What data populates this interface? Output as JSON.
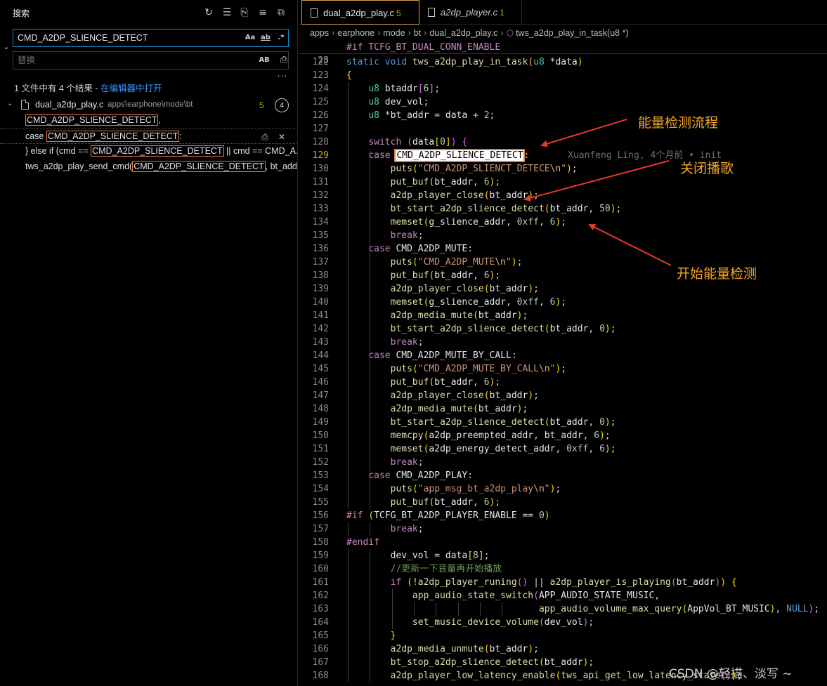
{
  "search_panel": {
    "title": "搜索",
    "search_value": "CMD_A2DP_SLIENCE_DETECT",
    "replace_placeholder": "替换",
    "opt_match_case": "Aa",
    "opt_whole_word": "ab",
    "opt_regex": ".*",
    "opt_preserve_case": "AB",
    "more": "...",
    "summary_text": "1 文件中有 4 个结果 - ",
    "summary_link": "在编辑器中打开",
    "file": {
      "name": "dual_a2dp_play.c",
      "path": "apps\\earphone\\mode\\bt",
      "problems": "5",
      "matches": "4"
    },
    "matches": [
      {
        "pre": "",
        "hit": "CMD_A2DP_SLIENCE_DETECT",
        "post": ","
      },
      {
        "pre": "case ",
        "hit": "CMD_A2DP_SLIENCE_DETECT",
        "post": ":"
      },
      {
        "pre": "} else if (cmd == ",
        "hit": "CMD_A2DP_SLIENCE_DETECT",
        "post": " || cmd == CMD_A..."
      },
      {
        "pre": "tws_a2dp_play_send_cmd(",
        "hit": "CMD_A2DP_SLIENCE_DETECT",
        "post": ", bt_addr, ..."
      }
    ]
  },
  "editor": {
    "tabs": [
      {
        "label": "dual_a2dp_play.c",
        "count": "5"
      },
      {
        "label": "a2dp_player.c",
        "count": "1"
      }
    ],
    "breadcrumb": [
      "apps",
      "earphone",
      "mode",
      "bt",
      "dual_a2dp_play.c",
      "tws_a2dp_play_in_task(u8 *)"
    ],
    "sticky": {
      "num": "28",
      "text": "#if TCFG_BT_DUAL_CONN_ENABLE"
    },
    "blame": "Xuanfeng Ling, 4个月前 • init",
    "line_numbers": [
      "122",
      "123",
      "124",
      "125",
      "126",
      "127",
      "128",
      "129",
      "130",
      "131",
      "132",
      "133",
      "134",
      "135",
      "136",
      "137",
      "138",
      "139",
      "140",
      "141",
      "142",
      "143",
      "144",
      "145",
      "146",
      "147",
      "148",
      "149",
      "150",
      "151",
      "152",
      "153",
      "154",
      "155",
      "156",
      "157",
      "158",
      "159",
      "160",
      "161",
      "162",
      "163",
      "164",
      "165",
      "166",
      "167",
      "168"
    ],
    "current_line": "129"
  },
  "annotations": {
    "energy_flow": "能量检测流程",
    "close_play": "关闭播歌",
    "start_detect": "开始能量检测"
  },
  "watermark": "CSDN @轻描、淡写 ~",
  "colors": {
    "accent_border": "#0e8fcf",
    "match_highlight": "#e07b39",
    "annotation": "#f5a623",
    "arrow": "#e8382b"
  }
}
